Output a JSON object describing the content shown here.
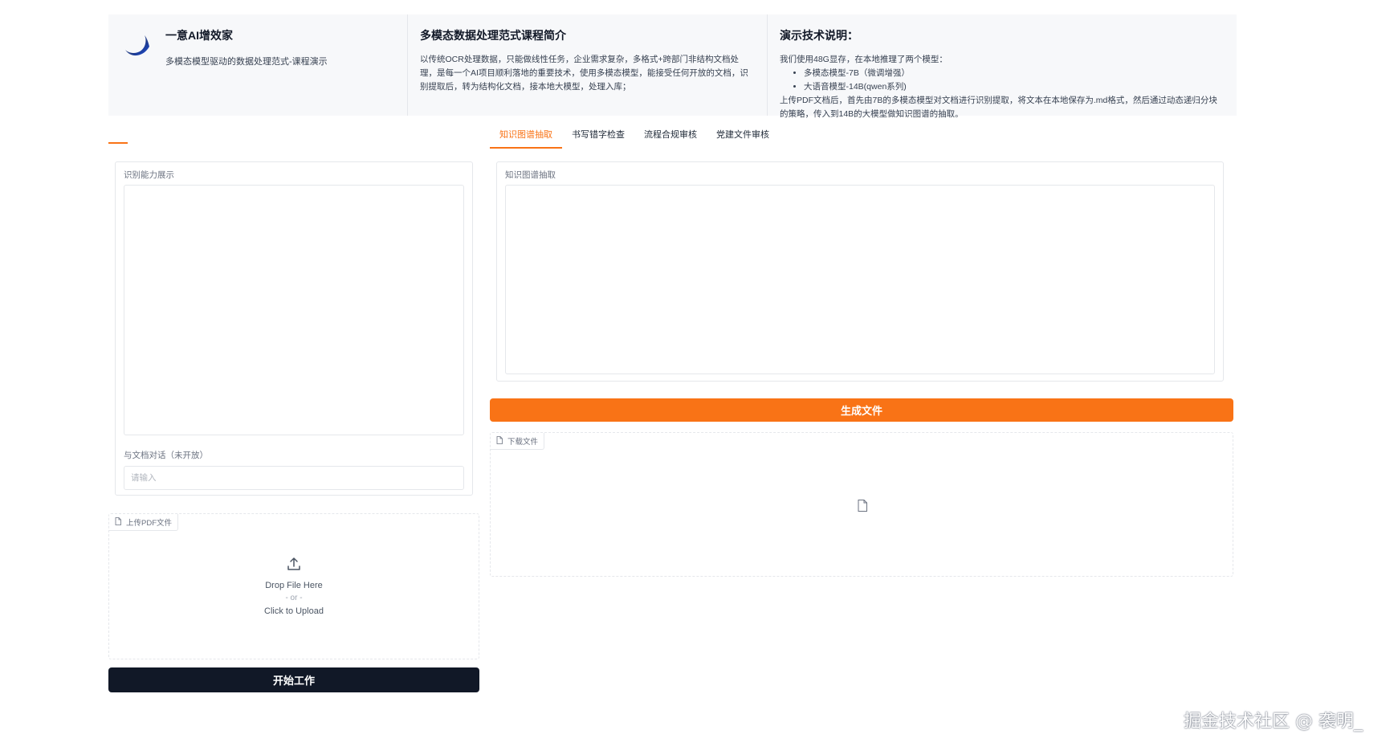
{
  "header": {
    "brand": {
      "title": "一意AI增效家",
      "subtitle": "多模态模型驱动的数据处理范式-课程演示"
    },
    "intro": {
      "title": "多模态数据处理范式课程简介",
      "body": "以传统OCR处理数据，只能做线性任务，企业需求复杂，多格式+跨部门非结构文档处理，是每一个AI项目顺利落地的重要技术，使用多模态模型，能接受任何开放的文档，识别提取后，转为结构化文档，接本地大模型，处理入库；"
    },
    "tech": {
      "title": "演示技术说明：",
      "intro": "我们使用48G显存，在本地推理了两个模型：",
      "models": [
        "多模态模型-7B（微调增强）",
        "大语音模型-14B(qwen系列)"
      ],
      "outro": "上传PDF文档后，首先由7B的多模态模型对文档进行识别提取，将文本在本地保存为.md格式，然后通过动态递归分块的策略，传入到14B的大模型做知识图谱的抽取。"
    }
  },
  "tabs": [
    {
      "label": "知识图谱抽取",
      "active": true
    },
    {
      "label": "书写错字检查",
      "active": false
    },
    {
      "label": "流程合规审核",
      "active": false
    },
    {
      "label": "党建文件审核",
      "active": false
    }
  ],
  "left_panel": {
    "label": "识别能力展示",
    "chat_label": "与文档对话（未开放）",
    "chat_placeholder": "请输入"
  },
  "upload": {
    "tag": "上传PDF文件",
    "drop": "Drop File Here",
    "or": "- or -",
    "click": "Click to Upload"
  },
  "start_button": "开始工作",
  "right_panel": {
    "label": "知识图谱抽取"
  },
  "generate_button": "生成文件",
  "download": {
    "tag": "下载文件"
  },
  "watermark": "掘金技术社区 @ 袭明_",
  "colors": {
    "accent": "#f97316",
    "dark_button": "#111827",
    "header_bg": "#f7f8fa"
  },
  "icons": {
    "logo": "crescent-logo-icon",
    "file": "file-icon",
    "upload": "upload-arrow-icon"
  }
}
